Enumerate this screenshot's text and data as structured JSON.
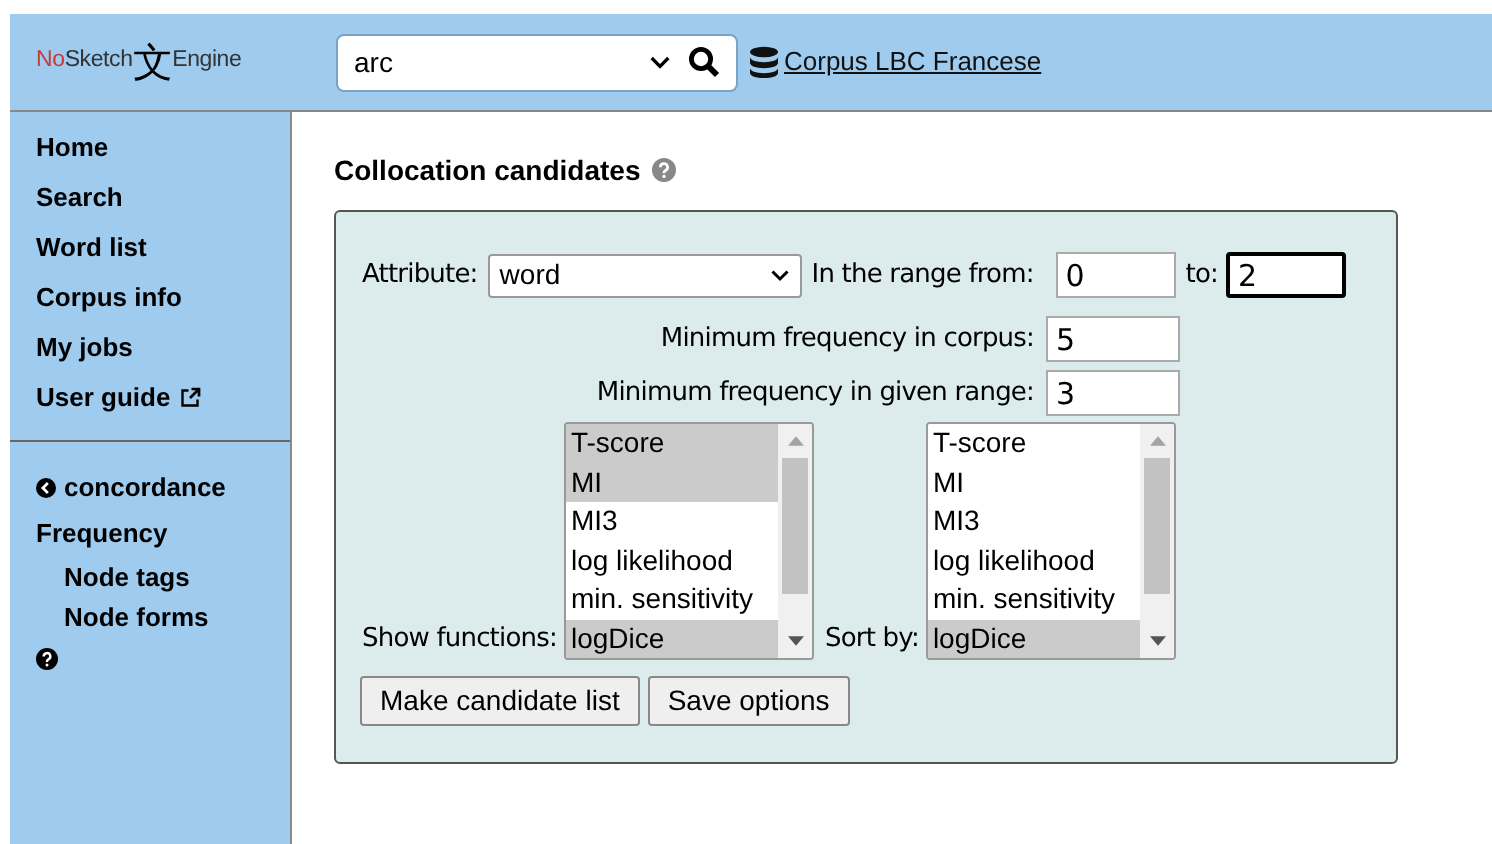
{
  "header": {
    "logo": {
      "prefix": "No",
      "name": "Sketch",
      "glyph": "文",
      "suffix": "Engine"
    },
    "search": {
      "value": "arc"
    },
    "corpus_link": "Corpus LBC Francese"
  },
  "sidebar": {
    "main_items": [
      {
        "label": "Home",
        "kind": "plain"
      },
      {
        "label": "Search",
        "kind": "plain"
      },
      {
        "label": "Word list",
        "kind": "plain"
      },
      {
        "label": "Corpus info",
        "kind": "plain"
      },
      {
        "label": "My jobs",
        "kind": "plain"
      },
      {
        "label": "User guide",
        "kind": "external"
      }
    ],
    "context_items": [
      {
        "label": "concordance",
        "kind": "back"
      },
      {
        "label": "Frequency",
        "kind": "plain",
        "children": [
          {
            "label": "Node tags",
            "kind": "plain"
          },
          {
            "label": "Node forms",
            "kind": "plain"
          }
        ]
      },
      {
        "kind": "help"
      }
    ]
  },
  "form": {
    "title": "Collocation candidates",
    "attribute": {
      "label": "Attribute:",
      "value": "word"
    },
    "range_from": {
      "label": "In the range from:",
      "value": "0",
      "focused": false
    },
    "range_to": {
      "label": "to:",
      "value": "2",
      "focused": true
    },
    "min_freq_corpus": {
      "label": "Minimum frequency in corpus:",
      "value": "5",
      "focused": false
    },
    "min_freq_range": {
      "label": "Minimum frequency in given range:",
      "value": "3",
      "focused": false
    },
    "show_functions": {
      "label": "Show functions:",
      "options": [
        {
          "label": "T-score",
          "selected": true
        },
        {
          "label": "MI",
          "selected": true
        },
        {
          "label": "MI3",
          "selected": false
        },
        {
          "label": "log likelihood",
          "selected": false
        },
        {
          "label": "min. sensitivity",
          "selected": false
        },
        {
          "label": "logDice",
          "selected": true
        }
      ]
    },
    "sort_by": {
      "label": "Sort by:",
      "options": [
        {
          "label": "T-score",
          "selected": false
        },
        {
          "label": "MI",
          "selected": false
        },
        {
          "label": "MI3",
          "selected": false
        },
        {
          "label": "log likelihood",
          "selected": false
        },
        {
          "label": "min. sensitivity",
          "selected": false
        },
        {
          "label": "logDice",
          "selected": true
        }
      ]
    },
    "buttons": [
      "Make candidate list",
      "Save options"
    ]
  }
}
